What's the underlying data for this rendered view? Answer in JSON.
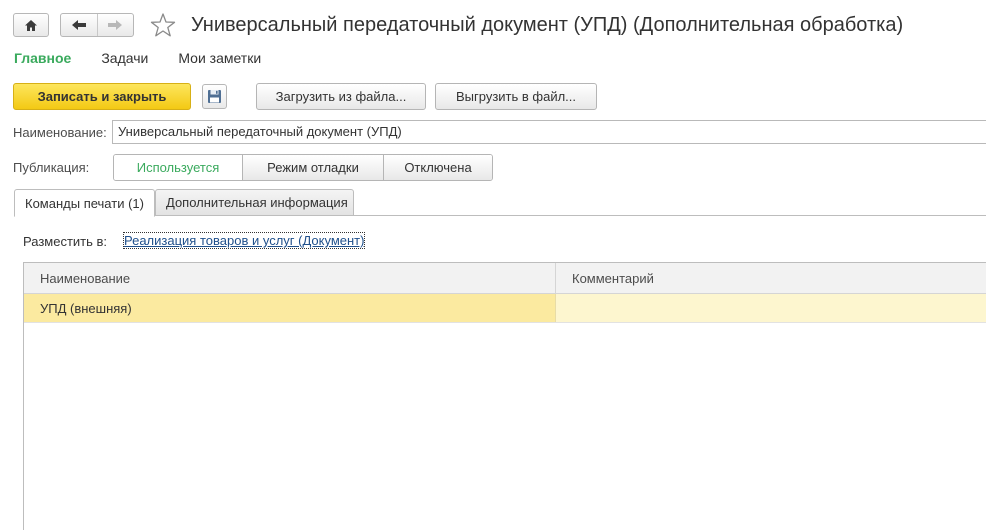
{
  "window": {
    "title": "Универсальный передаточный документ (УПД) (Дополнительная обработка)"
  },
  "nav": {
    "home_icon": "home-icon",
    "back_icon": "arrow-left-icon",
    "forward_icon": "arrow-right-icon",
    "favorite_icon": "star-icon"
  },
  "sections": [
    "Главное",
    "Задачи",
    "Мои заметки"
  ],
  "toolbar": {
    "save_close": "Записать и закрыть",
    "save_icon": "floppy-disk-icon",
    "load_from_file": "Загрузить из файла...",
    "upload_to_file": "Выгрузить в файл..."
  },
  "form": {
    "name_label": "Наименование:",
    "name_value": "Универсальный передаточный документ (УПД)",
    "publication_label": "Публикация:",
    "publication_options": [
      "Используется",
      "Режим отладки",
      "Отключена"
    ],
    "publication_selected": "Используется"
  },
  "tabs": [
    "Команды печати (1)",
    "Дополнительная информация"
  ],
  "print_commands": {
    "place_label": "Разместить в:",
    "place_link": "Реализация товаров и услуг (Документ)",
    "columns": [
      "Наименование",
      "Комментарий"
    ],
    "rows": [
      [
        "УПД (внешняя)",
        ""
      ]
    ]
  },
  "colors": {
    "accent_green": "#3aaa5d",
    "primary_button": "#f3c914",
    "selected_row": "#fbeaa0",
    "link": "#1f4f8b"
  }
}
